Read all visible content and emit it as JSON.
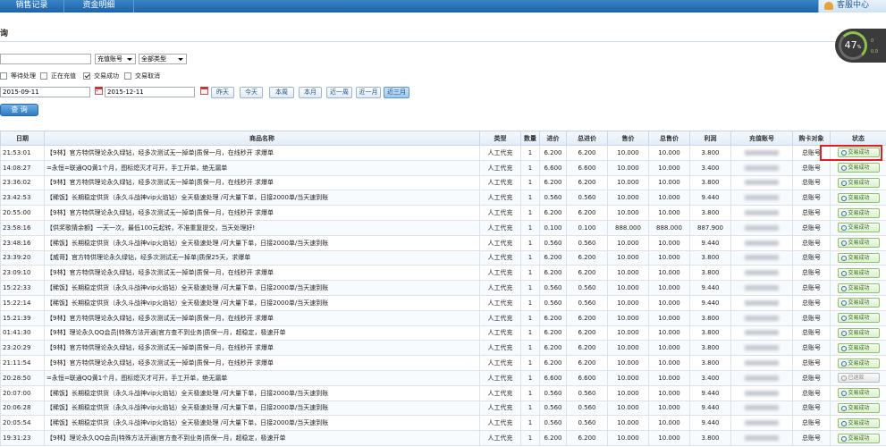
{
  "nav": {
    "tabs": [
      "销售记录",
      "资金明细"
    ],
    "service": "客服中心"
  },
  "page": {
    "title": "询"
  },
  "gauge": {
    "percent": "47",
    "unit": "%",
    "speeds": [
      "0",
      "0.0"
    ]
  },
  "filters": {
    "account_value": "",
    "account_type": "充值账号",
    "category": "全部类型",
    "statuses": [
      {
        "label": "等待处理",
        "checked": false
      },
      {
        "label": "正在充值",
        "checked": false
      },
      {
        "label": "交易成功",
        "checked": true
      },
      {
        "label": "交易取消",
        "checked": false
      }
    ],
    "start_date": "2015-09-11",
    "end_date": "2015-12-11",
    "date_sep": "-",
    "ranges": [
      "昨天",
      "今天",
      "本周",
      "本月",
      "近一周",
      "近一月",
      "近三月"
    ],
    "active_range": "近三月",
    "query_label": "查 询"
  },
  "table": {
    "headers": [
      "日期",
      "商品名称",
      "类型",
      "数量",
      "进价",
      "总进价",
      "售价",
      "总售价",
      "利润",
      "充值账号",
      "购卡对象",
      "状态"
    ],
    "rows": [
      [
        "21:53:01",
        "【9林】官方特供理论永久绿钻，经多次测试无一掉单|质保一月，在线秒开 求爆单",
        "人工代充",
        "1",
        "6.200",
        "6.200",
        "10.000",
        "10.000",
        "3.800",
        "",
        "总账号",
        "交易成功"
      ],
      [
        "14:08:27",
        "=永恒=联通QQ黄1个月，图标熄灭才可开，手工开单，绝无漏单",
        "人工代充",
        "1",
        "6.600",
        "6.600",
        "10.000",
        "10.000",
        "3.400",
        "",
        "总账号",
        "交易成功"
      ],
      [
        "23:36:02",
        "【9林】官方特供理论永久绿钻，经多次测试无一掉单|质保一月，在线秒开 求爆单",
        "人工代充",
        "1",
        "6.200",
        "6.200",
        "10.000",
        "10.000",
        "3.800",
        "",
        "总账号",
        "交易成功"
      ],
      [
        "23:42:53",
        "【稀饭】长期稳定供货（永久斗战神vip火焰钻）全天极速处理 /可大量下单，日接2000单/当天速到账",
        "人工代充",
        "1",
        "0.560",
        "0.560",
        "10.000",
        "10.000",
        "9.440",
        "",
        "总账号",
        "交易成功"
      ],
      [
        "20:55:00",
        "【9林】官方特供理论永久绿钻，经多次测试无一掉单|质保一月，在线秒开 求爆单",
        "人工代充",
        "1",
        "6.200",
        "6.200",
        "10.000",
        "10.000",
        "3.800",
        "",
        "总账号",
        "交易成功"
      ],
      [
        "23:58:16",
        "【供奖歌猜余额】一天一次，最低100元起转，不准重复提交，当天处理好!",
        "人工代充",
        "1",
        "0.100",
        "0.100",
        "888.000",
        "888.000",
        "887.900",
        "",
        "总账号",
        "交易成功"
      ],
      [
        "23:48:16",
        "【稀饭】长期稳定供货（永久斗战神vip火焰钻）全天极速处理 /可大量下单，日接2000单/当天速到账",
        "人工代充",
        "1",
        "0.560",
        "0.560",
        "10.000",
        "10.000",
        "9.440",
        "",
        "总账号",
        "交易成功"
      ],
      [
        "23:39:20",
        "【威哥】官方特供理论永久绿钻，经多次测试无一掉单|质保25天，求爆单",
        "人工代充",
        "1",
        "6.200",
        "6.200",
        "10.000",
        "10.000",
        "3.800",
        "",
        "总账号",
        "交易成功"
      ],
      [
        "23:09:10",
        "【9林】官方特供理论永久绿钻，经多次测试无一掉单|质保一月，在线秒开 求爆单",
        "人工代充",
        "1",
        "6.200",
        "6.200",
        "10.000",
        "10.000",
        "3.800",
        "",
        "总账号",
        "交易成功"
      ],
      [
        "15:22:33",
        "【稀饭】长期稳定供货（永久斗战神vip火焰钻）全天极速处理 /可大量下单，日接2000单/当天速到账",
        "人工代充",
        "1",
        "0.560",
        "0.560",
        "10.000",
        "10.000",
        "9.440",
        "",
        "总账号",
        "交易成功"
      ],
      [
        "15:22:14",
        "【稀饭】长期稳定供货（永久斗战神vip火焰钻）全天极速处理 /可大量下单，日接2000单/当天速到账",
        "人工代充",
        "1",
        "0.560",
        "0.560",
        "10.000",
        "10.000",
        "9.440",
        "",
        "总账号",
        "交易成功"
      ],
      [
        "15:21:39",
        "【9林】官方特供理论永久绿钻，经多次测试无一掉单|质保一月，在线秒开 求爆单",
        "人工代充",
        "1",
        "6.200",
        "6.200",
        "10.000",
        "10.000",
        "3.800",
        "",
        "总账号",
        "交易成功"
      ],
      [
        "01:41:30",
        "【9林】理论永久QQ会员|特殊方法开通|官方查不到业务|质保一月，超稳定，极速开单",
        "人工代充",
        "1",
        "6.200",
        "6.200",
        "10.000",
        "10.000",
        "3.800",
        "",
        "总账号",
        "交易成功"
      ],
      [
        "23:20:29",
        "【9林】官方特供理论永久绿钻，经多次测试无一掉单|质保一月，在线秒开 求爆单",
        "人工代充",
        "1",
        "6.200",
        "6.200",
        "10.000",
        "10.000",
        "3.800",
        "",
        "总账号",
        "交易成功"
      ],
      [
        "21:11:54",
        "【9林】官方特供理论永久绿钻，经多次测试无一掉单|质保一月，在线秒开 求爆单",
        "人工代充",
        "1",
        "6.200",
        "6.200",
        "10.000",
        "10.000",
        "3.800",
        "",
        "总账号",
        "交易成功"
      ],
      [
        "20:28:50",
        "=永恒=联通QQ黄1个月，图标熄灭才可开，手工开单，绝无漏单",
        "人工代充",
        "1",
        "6.600",
        "6.600",
        "10.000",
        "10.000",
        "3.400",
        "",
        "总账号",
        "已退款"
      ],
      [
        "20:07:00",
        "【稀饭】长期稳定供货（永久斗战神vip火焰钻）全天极速处理 /可大量下单，日接2000单/当天速到账",
        "人工代充",
        "1",
        "0.560",
        "0.560",
        "10.000",
        "10.000",
        "9.440",
        "",
        "总账号",
        "交易成功"
      ],
      [
        "20:06:28",
        "【稀饭】长期稳定供货（永久斗战神vip火焰钻）全天极速处理 /可大量下单，日接2000单/当天速到账",
        "人工代充",
        "1",
        "0.560",
        "0.560",
        "10.000",
        "10.000",
        "9.440",
        "",
        "总账号",
        "交易成功"
      ],
      [
        "20:05:54",
        "【稀饭】长期稳定供货（永久斗战神vip火焰钻）全天极速处理 /可大量下单，日接2000单/当天速到账",
        "人工代充",
        "1",
        "0.560",
        "0.560",
        "10.000",
        "10.000",
        "9.440",
        "",
        "总账号",
        "交易成功"
      ],
      [
        "19:31:23",
        "【9林】理论永久QQ会员|特殊方法开通|官方查不到业务|质保一月，超稳定，极速开单",
        "人工代充",
        "1",
        "6.200",
        "6.200",
        "10.000",
        "10.000",
        "3.800",
        "",
        "总账号",
        "交易成功"
      ]
    ]
  }
}
